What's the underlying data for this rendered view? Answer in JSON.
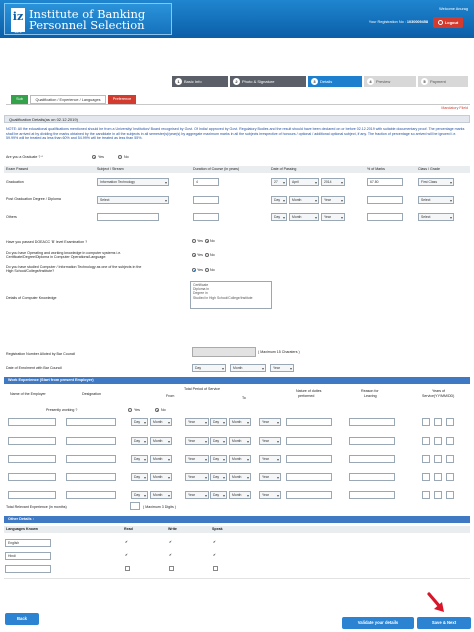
{
  "header": {
    "logo_text": "IBPS",
    "inst_name_line1": "Institute of Banking",
    "inst_name_line2": "Personnel Selection",
    "welcome": "Welcome Anurag",
    "reg_label": "Your Registration No :",
    "reg_no": "1030009458",
    "logout": "Logout"
  },
  "steps": [
    {
      "num": "1",
      "label": "Basic Info"
    },
    {
      "num": "2",
      "label": "Photo & Signature"
    },
    {
      "num": "3",
      "label": "Details"
    },
    {
      "num": "4",
      "label": "Preview"
    },
    {
      "num": "5",
      "label": "Payment"
    }
  ],
  "tabs": {
    "sub": "Sub",
    "qualification": "Qualification / Experience / Languages",
    "preference": "Preference"
  },
  "mandatory": "Mandatory Fileld",
  "qual_bar": "Qualification Details(as on 02.12.2019)",
  "note": "NOTE: All the educational qualifications mentioned should be from a University/ Institution/ Board recognised by Govt. Of India/ approved by Govt. Regulatory Bodies and the result should have been declared on or before 02.12.2019 with suitable documentary proof. The percentage marks shall be arrived at by dividing the marks obtained by the candidate in all the subjects in all semester(s)/year(s) by aggregate maximum marks in all the subjects irrespective of honours / optional / additional optional subject, if any. The fraction of percentage so arrived will be ignored i.e. 59.99% will be treated as less than 60% and 54.99% will be treated as less than 55%.",
  "graduate": {
    "label": "Are you a Graduate ? *",
    "yes": "Yes",
    "no": "No"
  },
  "qual_table": {
    "headers": [
      "Exam Passed",
      "Subject / Stream",
      "Duration of Course (in years)",
      "Date of Passing",
      "% of Marks",
      "Class / Grade"
    ],
    "rows": [
      {
        "exam": "Graduation",
        "subject": "Information Technology",
        "duration": "4",
        "day": "27",
        "month": "April",
        "year": "2014",
        "marks": "67.80",
        "grade": "First Class"
      },
      {
        "exam": "Post Graduation Degree / Diploma",
        "subject": "Select",
        "duration": "",
        "day": "Day",
        "month": "Month",
        "year": "Year",
        "marks": "",
        "grade": "Select"
      },
      {
        "exam": "Others",
        "subject": "",
        "duration": "",
        "day": "Day",
        "month": "Month",
        "year": "Year",
        "marks": "",
        "grade": "Select"
      }
    ]
  },
  "doeacc": {
    "label": "Have you passed DOEACC 'B' level Examination ?",
    "yes": "Yes",
    "no": "No"
  },
  "working_knowledge": {
    "label1": "Do you have Operating and working knowledge in computer systems i.e.",
    "label2": "Certificate/Degree/Diploma in Computer Operations/Language:",
    "yes": "Yes",
    "no": "No"
  },
  "studied_computer": {
    "label1": "Do you have studied Computer / Information Technology as one of the subjects in the",
    "label2": "High School/College/Institute?",
    "yes": "Yes",
    "no": "No"
  },
  "computer_knowledge": {
    "label": "Details of Computer Knowledge",
    "options": [
      "Certificate",
      "Diploma in",
      "Degree in",
      "Studied in High School/College/Institute"
    ]
  },
  "bar_council": {
    "reg_label": "Registration Number Alloted by Bar Council",
    "max": "( Maximum 15 Charaters )",
    "date_label": "Date of Enrolment with Bar Council",
    "day": "Day",
    "month": "Month",
    "year": "Year"
  },
  "work_bar": "Work Experience (Start from present Employer)",
  "work_table": {
    "name_emp": "Name of the Employer",
    "designation": "Designation",
    "total_period": "Total Period of Service",
    "from": "From",
    "to": "To",
    "nature1": "Nature of duties",
    "nature2": "performed",
    "reason1": "Reason for",
    "reason2": "Leaving",
    "years1": "Years of",
    "years2": "Service(YY/MM/DD)",
    "presently": "Presently working ?",
    "yes": "Yes",
    "no": "No",
    "day": "Day",
    "month": "Month",
    "year": "Year"
  },
  "total_exp": {
    "label": "Total Relevant Experience (in months)",
    "max": "( Maximum 3 Digits )"
  },
  "lang_bar": "Other Details :",
  "lang_table": {
    "headers": [
      "Languages Known",
      "Read",
      "Write",
      "Speak"
    ],
    "rows": [
      {
        "lang": "English",
        "read": "✔",
        "write": "✔",
        "speak": "✔"
      },
      {
        "lang": "Hindi",
        "read": "✔",
        "write": "✔",
        "speak": "✔"
      },
      {
        "lang": "",
        "read": "",
        "write": "",
        "speak": ""
      }
    ]
  },
  "buttons": {
    "back": "Back",
    "validate": "Validate your details",
    "save": "Save & Next"
  },
  "colors": {
    "header": "#0b5ea8",
    "accent": "#2b83d2",
    "sub_tab": "#33a24b",
    "pref_tab": "#d43b2f",
    "arrow": "#d9152a"
  }
}
